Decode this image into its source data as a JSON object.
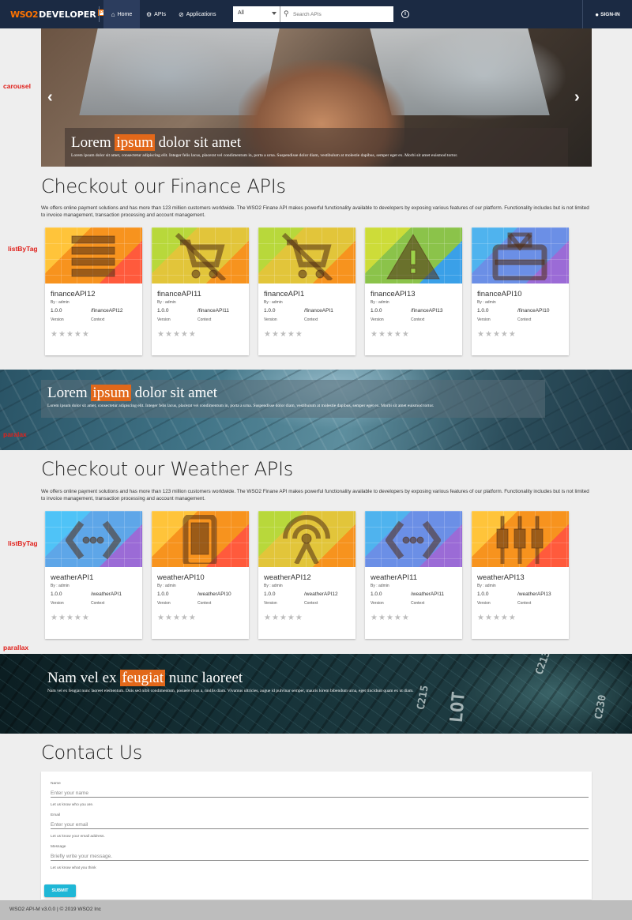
{
  "header": {
    "logo_wso2": "WSO2",
    "logo_developer": "DEVELOPER",
    "logo_portal": "PORTAL",
    "nav": [
      {
        "label": "Home",
        "icon": "home-icon"
      },
      {
        "label": "APIs",
        "icon": "gear-icon"
      },
      {
        "label": "Applications",
        "icon": "apps-icon"
      }
    ],
    "search_scope": "All",
    "search_placeholder": "Search APIs",
    "signin_label": "SIGN-IN"
  },
  "labels": {
    "carousel": "carousel",
    "listByTag1": "listByTag",
    "parallax1": "paralax",
    "listByTag2": "listByTag",
    "parallax2": "parallax"
  },
  "carousel": {
    "title_before": "Lorem ",
    "title_highlight": "ipsum",
    "title_after": " dolor sit amet",
    "text": "Lorem ipsum dolor sit amet, consectetur adipiscing elit. Integer felis lacus, placerat vel condimentum in, porta a urna. Suspendisse dolor diam, vestibulum at molestie dapibus, semper eget ex. Morbi sit amet euismod tortor."
  },
  "finance": {
    "title": "Checkout our Finance APIs",
    "description": "We offers online payment solutions and has more than 123 million customers worldwide. The WSO2 Finane API makes powerful functionality available to developers by exposing various features of our platform. Functionality includes but is not limited to invoice management, transaction processing and account management.",
    "cards": [
      {
        "name": "financeAPI12",
        "by": "By : admin",
        "version": "1.0.0",
        "context": "/financeAPI12",
        "version_label": "Version",
        "context_label": "Context",
        "icon": "list-icon",
        "color": "#f7931e",
        "rating": 0
      },
      {
        "name": "financeAPI11",
        "by": "By : admin",
        "version": "1.0.0",
        "context": "/financeAPI11",
        "version_label": "Version",
        "context_label": "Context",
        "icon": "cart-off-icon",
        "color": "#e2c53a",
        "rating": 0
      },
      {
        "name": "financeAPI1",
        "by": "By : admin",
        "version": "1.0.0",
        "context": "/financeAPI1",
        "version_label": "Version",
        "context_label": "Context",
        "icon": "cart-off-icon",
        "color": "#e2c53a",
        "rating": 0
      },
      {
        "name": "financeAPI13",
        "by": "By : admin",
        "version": "1.0.0",
        "context": "/financeAPI13",
        "version_label": "Version",
        "context_label": "Context",
        "icon": "warning-icon",
        "color": "#8bc34a",
        "rating": 0
      },
      {
        "name": "financeAPI10",
        "by": "By : admin",
        "version": "1.0.0",
        "context": "/financeAPI10",
        "version_label": "Version",
        "context_label": "Context",
        "icon": "gift-card-icon",
        "color": "#6b8fe6",
        "rating": 0
      }
    ]
  },
  "parallax1": {
    "title_before": "Lorem ",
    "title_highlight": "ipsum",
    "title_after": " dolor sit amet",
    "text": "Lorem ipsum dolor sit amet, consectetur adipiscing elit. Integer felis lacus, placerat vel condimentum in, porta a urna. Suspendisse dolor diam, vestibulum at molestie dapibus, semper eget ex. Morbi sit amet euismod tortor."
  },
  "weather": {
    "title": "Checkout our Weather APIs",
    "description": "We offers online payment solutions and has more than 123 million customers worldwide. The WSO2 Finane API makes powerful functionality available to developers by exposing various features of our platform. Functionality includes but is not limited to invoice management, transaction processing and account management.",
    "cards": [
      {
        "name": "weatherAPI1",
        "by": "By : admin",
        "version": "1.0.0",
        "context": "/weatherAPI1",
        "version_label": "Version",
        "context_label": "Context",
        "icon": "code-icon",
        "color": "#5ea6e8",
        "rating": 0
      },
      {
        "name": "weatherAPI10",
        "by": "By : admin",
        "version": "1.0.0",
        "context": "/weatherAPI10",
        "version_label": "Version",
        "context_label": "Context",
        "icon": "mobile-icon",
        "color": "#f7931e",
        "rating": 0
      },
      {
        "name": "weatherAPI12",
        "by": "By : admin",
        "version": "1.0.0",
        "context": "/weatherAPI12",
        "version_label": "Version",
        "context_label": "Context",
        "icon": "antenna-icon",
        "color": "#e2c53a",
        "rating": 0
      },
      {
        "name": "weatherAPI11",
        "by": "By : admin",
        "version": "1.0.0",
        "context": "/weatherAPI11",
        "version_label": "Version",
        "context_label": "Context",
        "icon": "code-icon",
        "color": "#6b8fe6",
        "rating": 0
      },
      {
        "name": "weatherAPI13",
        "by": "By : admin",
        "version": "1.0.0",
        "context": "/weatherAPI13",
        "version_label": "Version",
        "context_label": "Context",
        "icon": "plug-icon",
        "color": "#f7931e",
        "rating": 0
      }
    ]
  },
  "parallax2": {
    "title_before": "Nam vel ex ",
    "title_highlight": "feugiat",
    "title_after": " nunc laoreet",
    "text": "Nam vel ex feugiat nunc laoreet elementum. Duis sed nibh condimentum, posuere risus a, mollis diam. Vivamus ultricies, augue id pulvinar semper, mauris lorem bibendum urna, eget tincidunt quam ex ut diam."
  },
  "contact": {
    "title": "Contact Us",
    "name_label": "Name",
    "name_placeholder": "Enter your name",
    "name_help": "Let us know who you are.",
    "email_label": "Email",
    "email_placeholder": "Enter your email",
    "email_help": "Let us know your email address.",
    "message_label": "Message",
    "message_placeholder": "Briefly write your message.",
    "message_help": "Let us know what you think",
    "submit_label": "SUBMIT"
  },
  "footer": {
    "text": "WSO2 API-M v3.0.0 | © 2019 WSO2 Inc"
  }
}
